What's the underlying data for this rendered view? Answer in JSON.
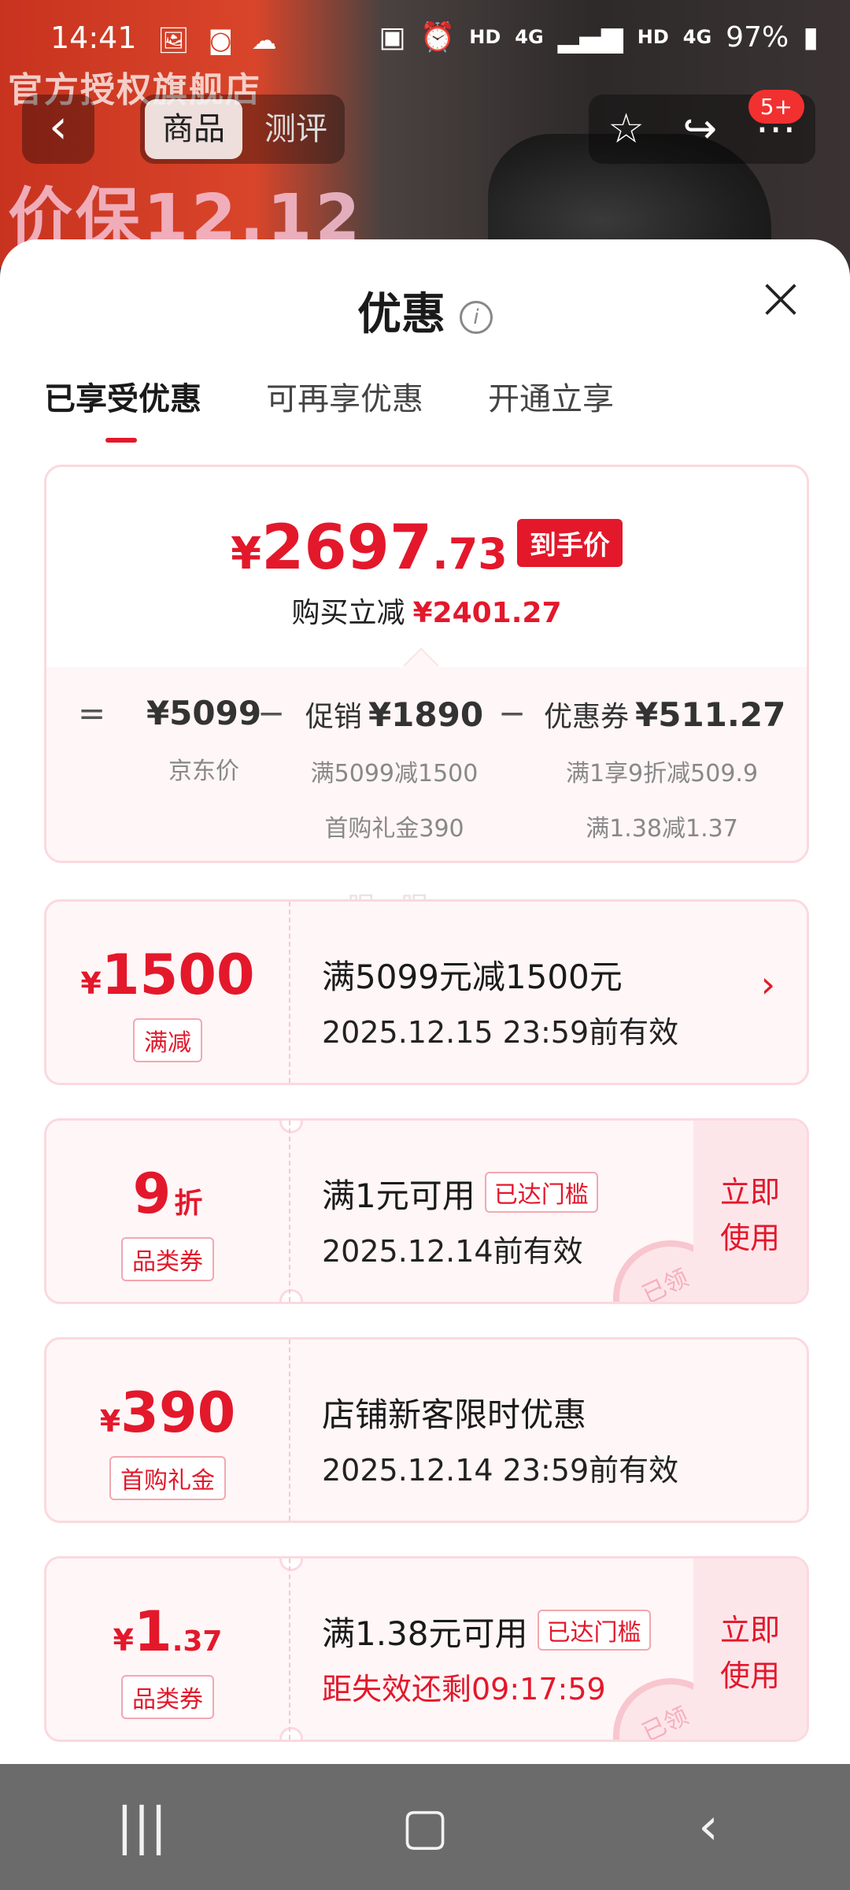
{
  "status_bar": {
    "time": "14:41",
    "battery": "97%",
    "network_labels": [
      "HD",
      "4G",
      "HD",
      "4G"
    ]
  },
  "background": {
    "banner_line1": "官方授权旗舰店",
    "banner_line2": "价保12.12"
  },
  "top_nav": {
    "tabs": [
      {
        "label": "商品"
      },
      {
        "label": "测评"
      }
    ],
    "message_badge": "5+"
  },
  "sheet": {
    "title": "优惠",
    "tabs": [
      {
        "label": "已享受优惠",
        "active": true
      },
      {
        "label": "可再享优惠",
        "active": false
      },
      {
        "label": "开通立享",
        "active": false
      }
    ],
    "summary": {
      "price_currency": "¥",
      "price_integer": "2697",
      "price_decimal": ".73",
      "price_tag": "到手价",
      "save_label": "购买立减",
      "save_value": "¥2401.27",
      "breakdown": {
        "eq": "=",
        "minus": "−",
        "jd_price": "¥5099",
        "jd_label": "京东价",
        "promo_label": "促销",
        "promo_value": "¥1890",
        "promo_sub1": "满5099减1500",
        "promo_sub2": "首购礼金390",
        "coupon_label": "优惠券",
        "coupon_value": "¥511.27",
        "coupon_sub1": "满1享9折减509.9",
        "coupon_sub2": "满1.38减1.37"
      }
    },
    "watermark": "眠一眠",
    "coupons": [
      {
        "currency": "¥",
        "amount": "1500",
        "type": "满减",
        "title": "满5099元减1500元",
        "subtitle": "2025.12.15 23:59前有效"
      },
      {
        "amount": "9",
        "unit": "折",
        "type": "品类券",
        "title": "满1元可用",
        "reach_tag": "已达门槛",
        "subtitle": "2025.12.14前有效",
        "use_label_1": "立即",
        "use_label_2": "使用",
        "stamp": "已领"
      },
      {
        "currency": "¥",
        "amount": "390",
        "type": "首购礼金",
        "title": "店铺新客限时优惠",
        "subtitle": "2025.12.14 23:59前有效"
      },
      {
        "currency": "¥",
        "amount": "1",
        "decimal": ".37",
        "type": "品类券",
        "title": "满1.38元可用",
        "reach_tag": "已达门槛",
        "subtitle": "距失效还剩09:17:59",
        "use_label_1": "立即",
        "use_label_2": "使用",
        "stamp": "已领"
      }
    ]
  },
  "colors": {
    "accent_red": "#e3182b",
    "card_border": "#fbd9df",
    "card_bg": "#fff6f7",
    "sysnav_bg": "#6b6b6b"
  }
}
